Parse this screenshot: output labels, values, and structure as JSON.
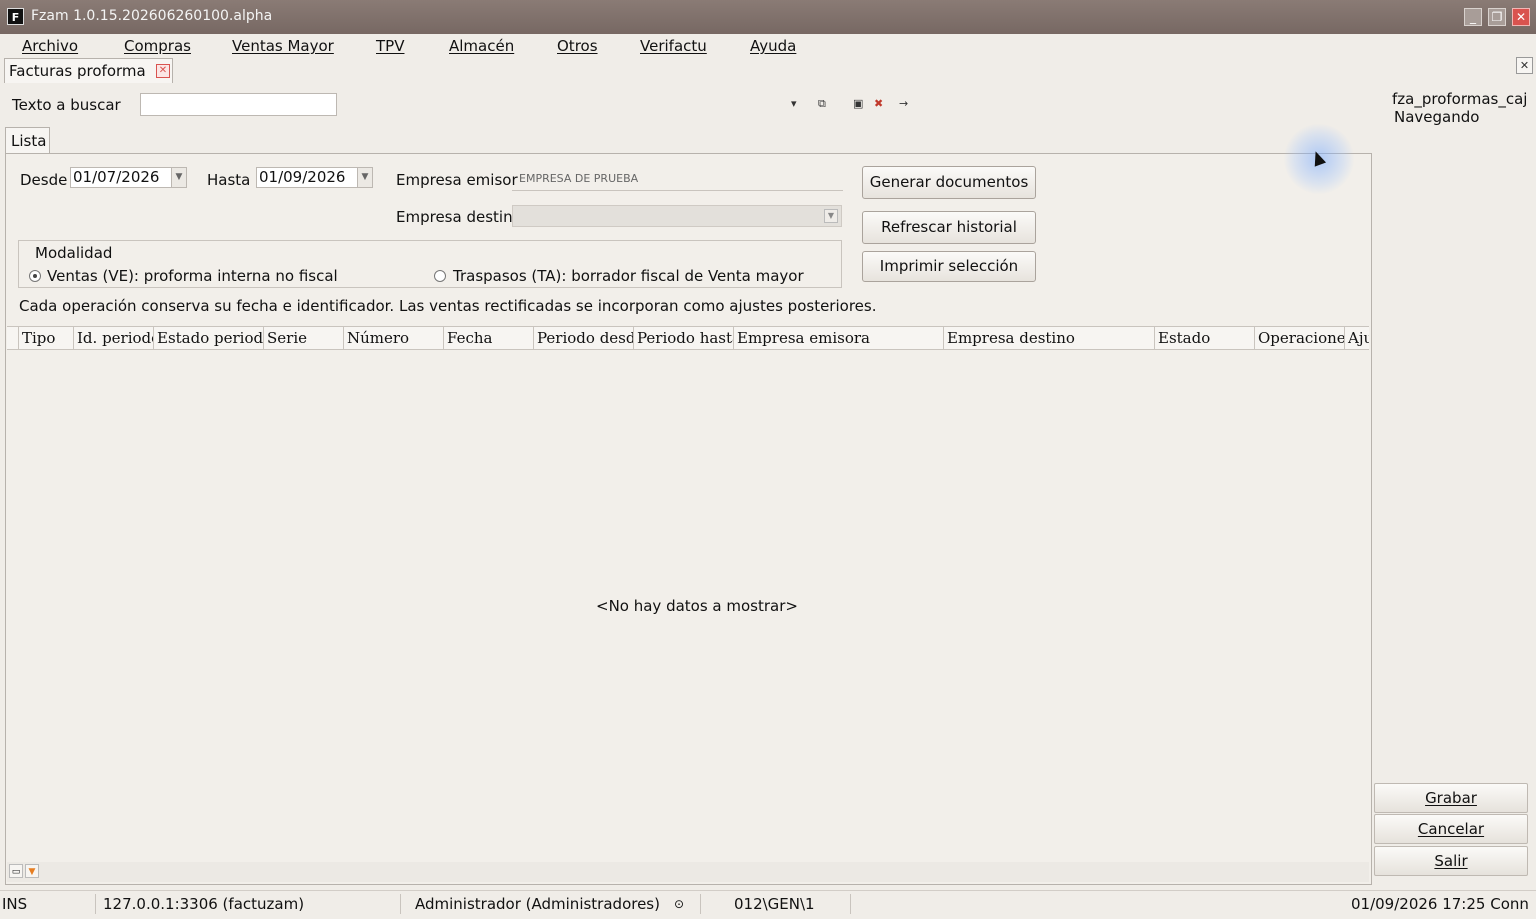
{
  "window": {
    "title": "Fzam 1.0.15.202606260100.alpha",
    "app_icon_letter": "F",
    "minimize": "_",
    "maximize": "❐",
    "close": "✕"
  },
  "menu": {
    "items": [
      "Archivo",
      "Compras",
      "Ventas Mayor",
      "TPV",
      "Almacén",
      "Otros",
      "Verifactu",
      "Ayuda"
    ]
  },
  "doc_tab": {
    "label": "Facturas proforma",
    "close": "✕"
  },
  "panel_close": "✕",
  "search": {
    "label": "Texto a buscar",
    "value": ""
  },
  "toolbar": {
    "dropdown": "▾",
    "icon2": "⧉",
    "icon3": "▣",
    "icon4": "✖",
    "icon5": "→"
  },
  "module": {
    "name": "fza_proformas_caj",
    "state": "Navegando"
  },
  "inner_tab": {
    "label": "Lista"
  },
  "filters": {
    "desde_label": "Desde",
    "desde_value": "01/07/2026",
    "hasta_label": "Hasta",
    "hasta_value": "01/09/2026",
    "emisora_label": "Empresa emisor",
    "emisora_value": "EMPRESA DE PRUEBA",
    "destino_label": "Empresa destino",
    "dropdown_arrow": "▼"
  },
  "buttons": {
    "generar": "Generar documentos",
    "refrescar": "Refrescar historial",
    "imprimir": "Imprimir selección"
  },
  "modalidad": {
    "title": "Modalidad",
    "option1": "Ventas (VE): proforma interna no fiscal",
    "option2": "Traspasos (TA): borrador fiscal de Venta mayor",
    "selected": "option1"
  },
  "info_text": "Cada operación conserva su fecha e identificador. Las ventas rectificadas se incorporan como ajustes posteriores.",
  "grid": {
    "columns": [
      "Tipo",
      "Id. periodo",
      "Estado periodo",
      "Serie",
      "Número",
      "Fecha",
      "Periodo desde",
      "Periodo hasta",
      "Empresa emisora",
      "Empresa destino",
      "Estado",
      "Operaciones",
      "Ajustes"
    ],
    "empty_message": "<No hay datos a mostrar>",
    "footer_icon1": "▭",
    "footer_icon2": "▼"
  },
  "side_buttons": {
    "grabar": "Grabar",
    "cancelar": "Cancelar",
    "salir": "Salir"
  },
  "status": {
    "mode": "INS",
    "connection": "127.0.0.1:3306 (factuzam)",
    "user": "Administrador (Administradores)",
    "user_icon": "⊙",
    "path": "012\\GEN\\1",
    "datetime": "01/09/2026 17:25 Conn"
  }
}
